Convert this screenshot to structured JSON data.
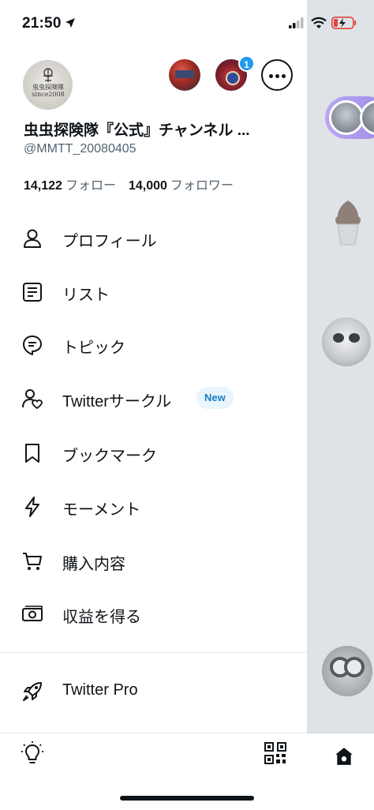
{
  "status_bar": {
    "time": "21:50",
    "location_icon": "location-arrow-icon",
    "signal_icon": "cellular-signal-icon",
    "wifi_icon": "wifi-icon",
    "battery_icon": "battery-low-charging-icon"
  },
  "profile": {
    "display_name": "虫虫探険隊『公式』チャンネル ...",
    "handle": "@MMTT_20080405",
    "following_count": "14,122",
    "following_label": "フォロー",
    "followers_count": "14,000",
    "followers_label": "フォロワー",
    "avatar_text": "虫虫探険隊 since2008",
    "other_accounts_badge": "1"
  },
  "menu": {
    "items": [
      {
        "label": "プロフィール",
        "icon": "person-icon"
      },
      {
        "label": "リスト",
        "icon": "list-icon"
      },
      {
        "label": "トピック",
        "icon": "topic-icon"
      },
      {
        "label": "Twitterサークル",
        "icon": "circle-people-icon",
        "badge": "New"
      },
      {
        "label": "ブックマーク",
        "icon": "bookmark-icon"
      },
      {
        "label": "モーメント",
        "icon": "lightning-icon"
      },
      {
        "label": "購入内容",
        "icon": "cart-icon"
      },
      {
        "label": "収益を得る",
        "icon": "money-icon"
      },
      {
        "label": "Twitter Pro",
        "icon": "rocket-icon"
      }
    ]
  },
  "bottom": {
    "left_icon": "lightbulb-icon",
    "right_icon": "qr-code-icon"
  },
  "colors": {
    "accent": "#1d9bf0",
    "text_primary": "#0f1419",
    "text_secondary": "#536471",
    "overlay": "#dfe3e8"
  }
}
